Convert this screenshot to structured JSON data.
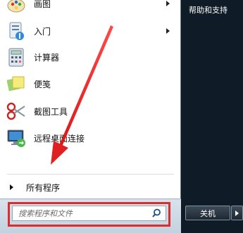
{
  "programs": [
    {
      "label": "画图",
      "icon": "paint-icon",
      "has_submenu": true
    },
    {
      "label": "入门",
      "icon": "getting-started-icon",
      "has_submenu": true
    },
    {
      "label": "计算器",
      "icon": "calculator-icon",
      "has_submenu": false
    },
    {
      "label": "便笺",
      "icon": "sticky-notes-icon",
      "has_submenu": false
    },
    {
      "label": "截图工具",
      "icon": "snipping-tool-icon",
      "has_submenu": false
    },
    {
      "label": "远程桌面连接",
      "icon": "remote-desktop-icon",
      "has_submenu": false
    }
  ],
  "all_programs": {
    "label": "所有程序"
  },
  "search": {
    "placeholder": "搜索程序和文件",
    "value": ""
  },
  "right_panel": {
    "help_label": "帮助和支持"
  },
  "shutdown": {
    "label": "关机"
  },
  "colors": {
    "highlight": "#e12a2a",
    "menu_background": "#ffffff",
    "right_panel": "#0f1b26"
  }
}
